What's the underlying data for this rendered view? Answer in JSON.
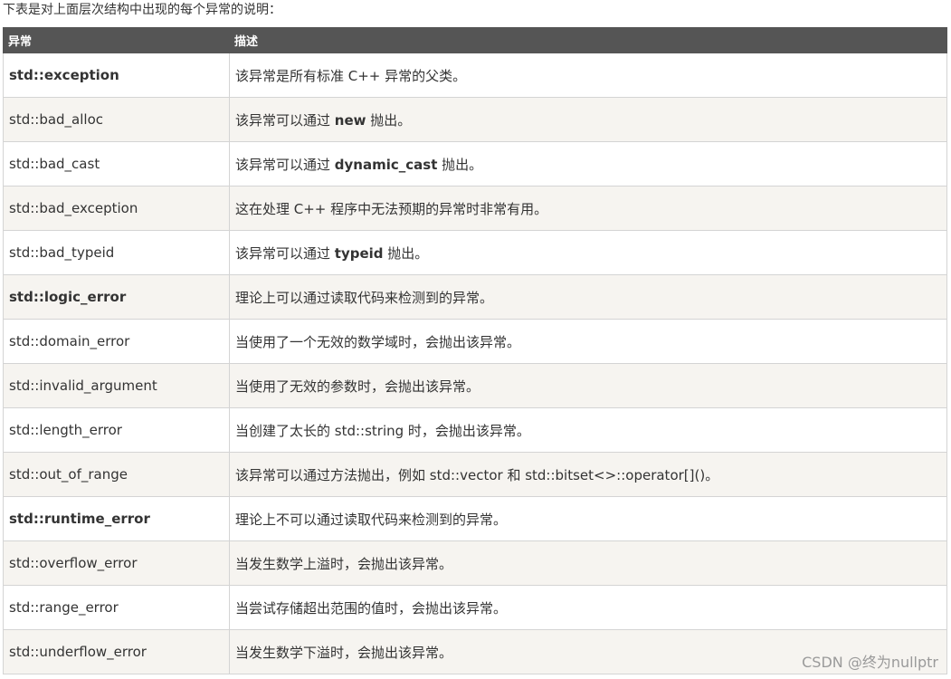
{
  "intro": "下表是对上面层次结构中出现的每个异常的说明：",
  "table": {
    "headers": [
      "异常",
      "描述"
    ],
    "rows": [
      {
        "name": "std::exception",
        "bold": true,
        "desc": [
          {
            "t": "该异常是所有标准 C++ 异常的父类。"
          }
        ]
      },
      {
        "name": "std::bad_alloc",
        "bold": false,
        "desc": [
          {
            "t": "该异常可以通过 "
          },
          {
            "t": "new",
            "b": true
          },
          {
            "t": " 抛出。"
          }
        ]
      },
      {
        "name": "std::bad_cast",
        "bold": false,
        "desc": [
          {
            "t": "该异常可以通过 "
          },
          {
            "t": "dynamic_cast",
            "b": true
          },
          {
            "t": " 抛出。"
          }
        ]
      },
      {
        "name": "std::bad_exception",
        "bold": false,
        "desc": [
          {
            "t": "这在处理 C++ 程序中无法预期的异常时非常有用。"
          }
        ]
      },
      {
        "name": "std::bad_typeid",
        "bold": false,
        "desc": [
          {
            "t": "该异常可以通过 "
          },
          {
            "t": "typeid",
            "b": true
          },
          {
            "t": " 抛出。"
          }
        ]
      },
      {
        "name": "std::logic_error",
        "bold": true,
        "desc": [
          {
            "t": "理论上可以通过读取代码来检测到的异常。"
          }
        ]
      },
      {
        "name": "std::domain_error",
        "bold": false,
        "desc": [
          {
            "t": "当使用了一个无效的数学域时，会抛出该异常。"
          }
        ]
      },
      {
        "name": "std::invalid_argument",
        "bold": false,
        "desc": [
          {
            "t": "当使用了无效的参数时，会抛出该异常。"
          }
        ]
      },
      {
        "name": "std::length_error",
        "bold": false,
        "desc": [
          {
            "t": "当创建了太长的 std::string 时，会抛出该异常。"
          }
        ]
      },
      {
        "name": "std::out_of_range",
        "bold": false,
        "desc": [
          {
            "t": "该异常可以通过方法抛出，例如 std::vector 和 std::bitset<>::operator[]()。"
          }
        ]
      },
      {
        "name": "std::runtime_error",
        "bold": true,
        "desc": [
          {
            "t": "理论上不可以通过读取代码来检测到的异常。"
          }
        ]
      },
      {
        "name": "std::overflow_error",
        "bold": false,
        "desc": [
          {
            "t": "当发生数学上溢时，会抛出该异常。"
          }
        ]
      },
      {
        "name": "std::range_error",
        "bold": false,
        "desc": [
          {
            "t": "当尝试存储超出范围的值时，会抛出该异常。"
          }
        ]
      },
      {
        "name": "std::underflow_error",
        "bold": false,
        "desc": [
          {
            "t": "当发生数学下溢时，会抛出该异常。"
          }
        ]
      }
    ]
  },
  "watermark": "CSDN @终为nullptr"
}
